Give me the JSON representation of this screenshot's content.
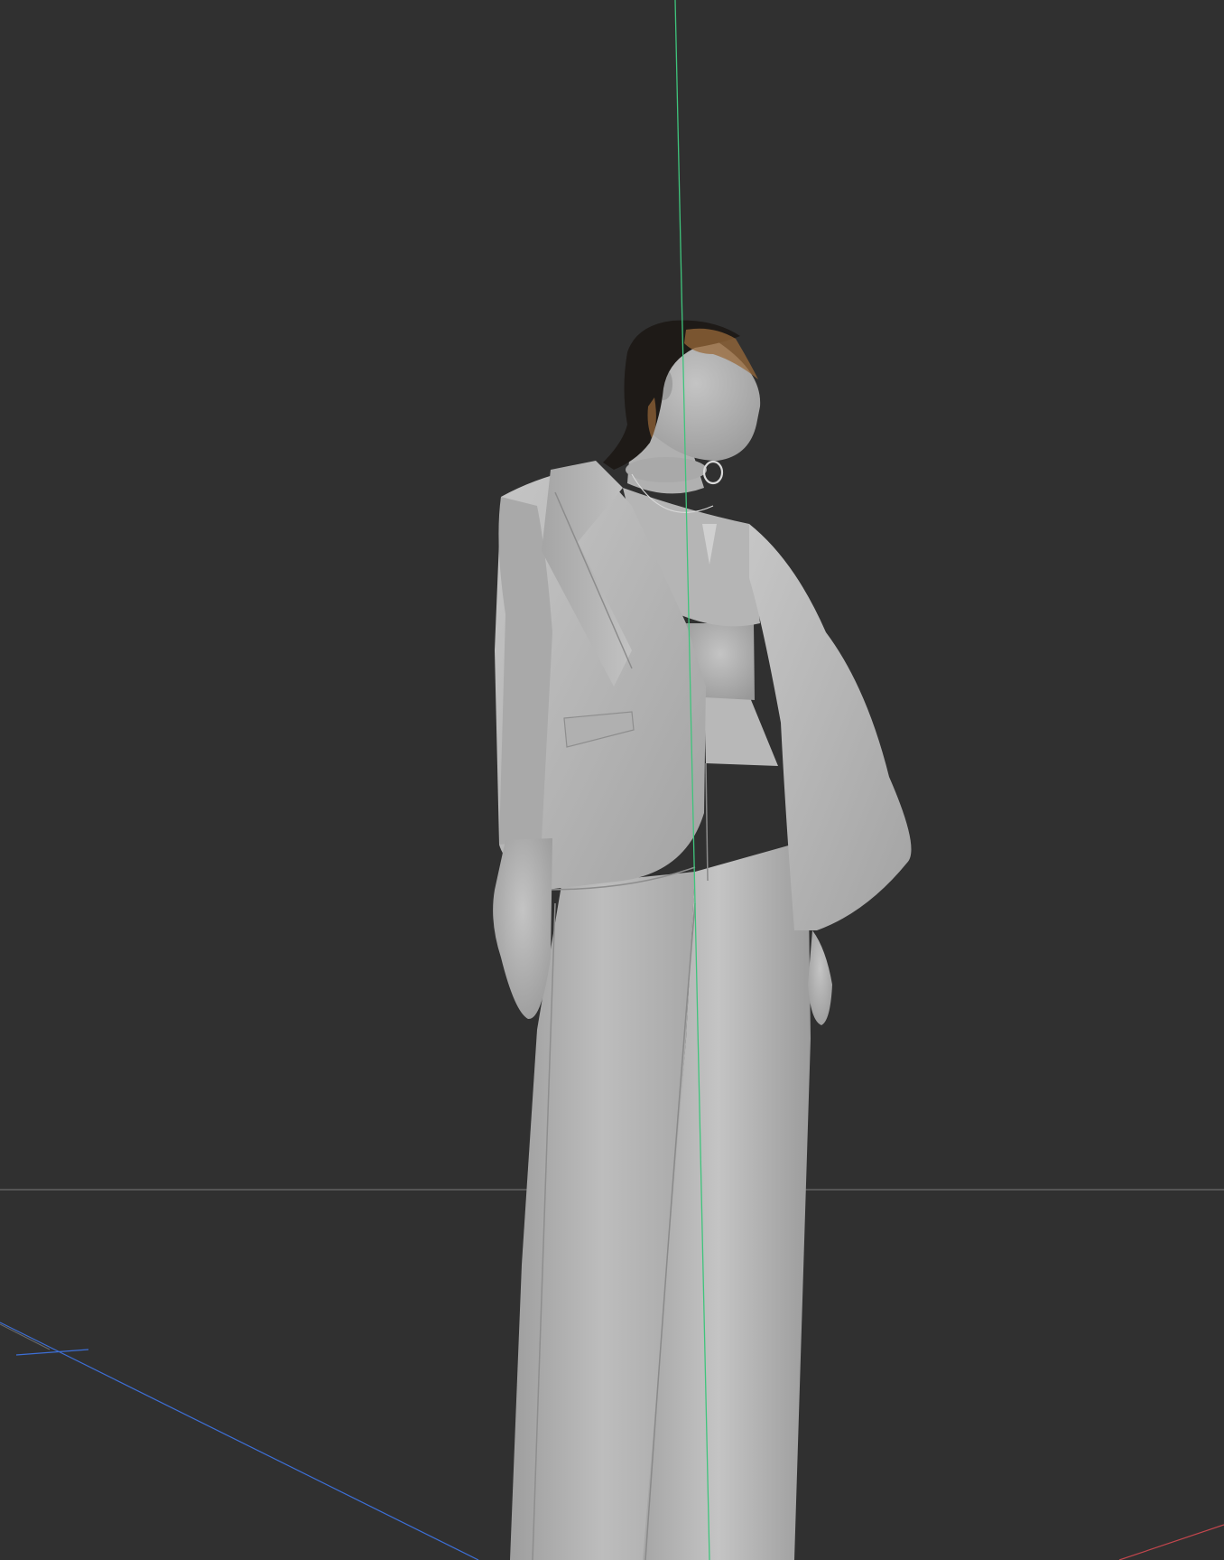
{
  "viewport": {
    "background": "#303030",
    "shading_mode": "solid",
    "overlays": {
      "floor_grid_horizon": true,
      "axis_colors": {
        "x": "#c2464d",
        "y": "#3fc47c",
        "z": "#3d6fd6"
      }
    },
    "scene": {
      "subject": "figure-in-suit",
      "material_color": "#b4b4b4",
      "hair_color": "#1e1a17",
      "hair_accent_color": "#9a6a3a"
    }
  }
}
